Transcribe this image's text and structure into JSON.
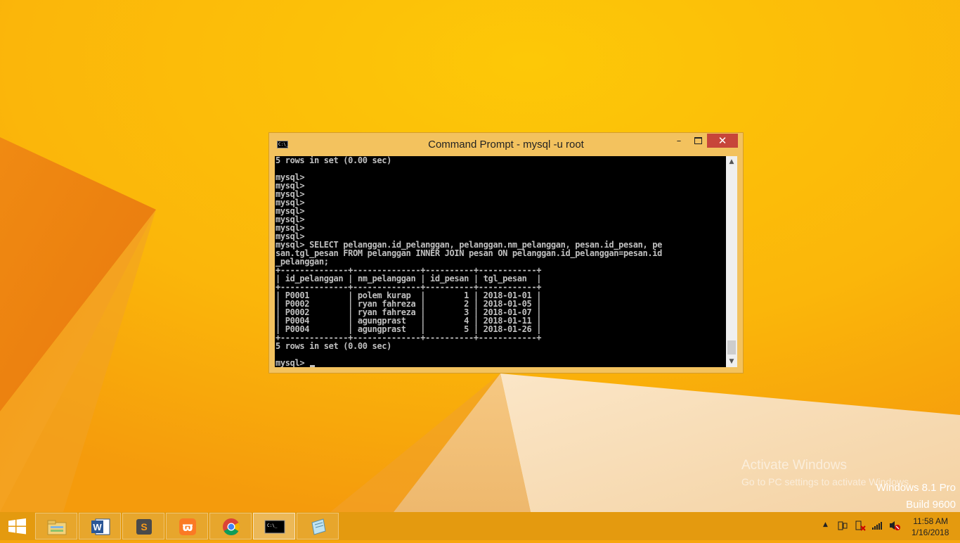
{
  "window": {
    "title": "Command Prompt - mysql  -u root",
    "icon_text": "C:\\_",
    "minimize": "–",
    "close": "✕"
  },
  "console": {
    "text": "5 rows in set (0.00 sec)\n\nmysql>\nmysql>\nmysql>\nmysql>\nmysql>\nmysql>\nmysql>\nmysql>\nmysql> SELECT pelanggan.id_pelanggan, pelanggan.nm_pelanggan, pesan.id_pesan, pe\nsan.tgl_pesan FROM pelanggan INNER JOIN pesan ON pelanggan.id_pelanggan=pesan.id\n_pelanggan;\n+--------------+--------------+----------+------------+\n| id_pelanggan | nm_pelanggan | id_pesan | tgl_pesan  |\n+--------------+--------------+----------+------------+\n| P0001        | polem kurap  |        1 | 2018-01-01 |\n| P0002        | ryan fahreza |        2 | 2018-01-05 |\n| P0002        | ryan fahreza |        3 | 2018-01-07 |\n| P0004        | agungprast   |        4 | 2018-01-11 |\n| P0004        | agungprast   |        5 | 2018-01-26 |\n+--------------+--------------+----------+------------+\n5 rows in set (0.00 sec)\n\nmysql> "
  },
  "watermark": {
    "title": "Activate Windows",
    "subtitle": "Go to PC settings to activate Windows.",
    "version_line1": "Windows 8.1 Pro",
    "version_line2": "Build 9600"
  },
  "taskbar": {
    "apps": [
      {
        "name": "file-explorer-icon",
        "active": false
      },
      {
        "name": "word-icon",
        "label": "W",
        "active": false
      },
      {
        "name": "sublime-text-icon",
        "label": "S",
        "active": false
      },
      {
        "name": "xampp-icon",
        "label": "ϖ",
        "active": false
      },
      {
        "name": "chrome-icon",
        "active": false
      },
      {
        "name": "command-prompt-icon",
        "label": "C:\\_",
        "active": true
      },
      {
        "name": "notepad-icon",
        "active": false
      }
    ],
    "clock_time": "11:58 AM",
    "clock_date": "1/16/2018"
  },
  "colors": {
    "desktop_bg": "#f7a60c",
    "taskbar": "#e49a0f",
    "close_button": "#c7453a",
    "console_bg": "#000000",
    "console_text": "#c0c0c0"
  }
}
